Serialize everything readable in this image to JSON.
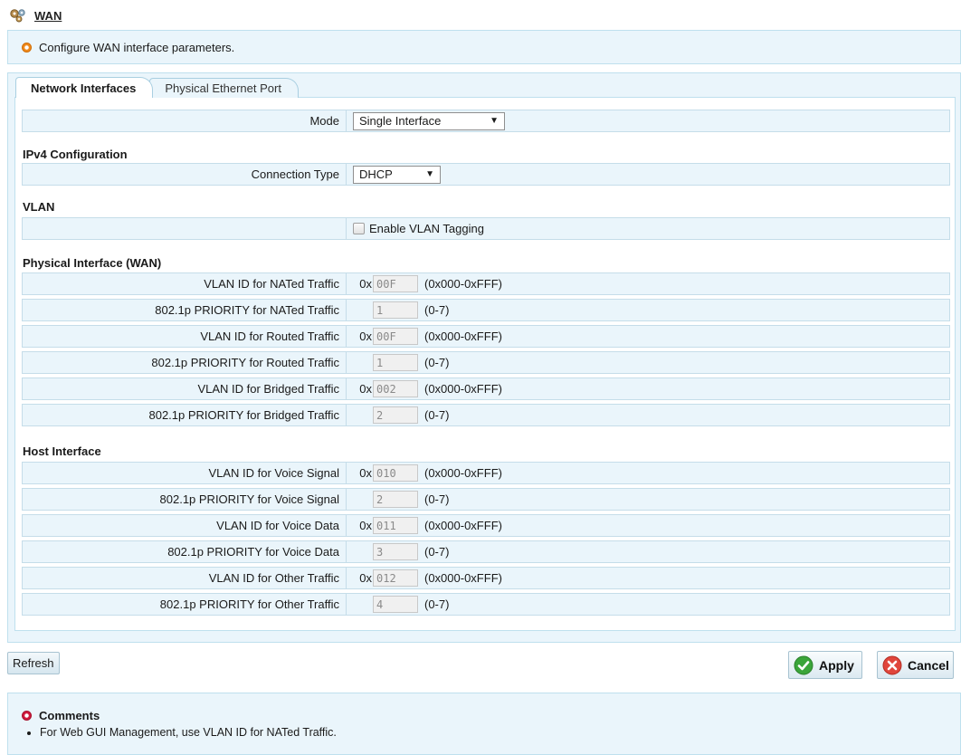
{
  "header": {
    "title": "WAN",
    "icon": "gears-icon"
  },
  "info": {
    "text": "Configure WAN interface parameters."
  },
  "tabs": [
    {
      "label": "Network Interfaces",
      "active": true
    },
    {
      "label": "Physical Ethernet Port",
      "active": false
    }
  ],
  "mode": {
    "label": "Mode",
    "value": "Single Interface"
  },
  "ipv4": {
    "title": "IPv4 Configuration",
    "connection_type_label": "Connection Type",
    "connection_type_value": "DHCP"
  },
  "vlan": {
    "title": "VLAN",
    "enable_tagging_label": "Enable VLAN Tagging",
    "enable_tagging_checked": false
  },
  "physical": {
    "title": "Physical Interface (WAN)",
    "rows": [
      {
        "label": "VLAN ID for NATed Traffic",
        "prefix": "0x",
        "value": "00F",
        "range": "(0x000-0xFFF)"
      },
      {
        "label": "802.1p PRIORITY for NATed Traffic",
        "prefix": "",
        "value": "1",
        "range": "(0-7)"
      },
      {
        "label": "VLAN ID for Routed Traffic",
        "prefix": "0x",
        "value": "00F",
        "range": "(0x000-0xFFF)"
      },
      {
        "label": "802.1p PRIORITY for Routed Traffic",
        "prefix": "",
        "value": "1",
        "range": "(0-7)"
      },
      {
        "label": "VLAN ID for Bridged Traffic",
        "prefix": "0x",
        "value": "002",
        "range": "(0x000-0xFFF)"
      },
      {
        "label": "802.1p PRIORITY for Bridged Traffic",
        "prefix": "",
        "value": "2",
        "range": "(0-7)"
      }
    ]
  },
  "host": {
    "title": "Host Interface",
    "rows": [
      {
        "label": "VLAN ID for Voice Signal",
        "prefix": "0x",
        "value": "010",
        "range": "(0x000-0xFFF)"
      },
      {
        "label": "802.1p PRIORITY for Voice Signal",
        "prefix": "",
        "value": "2",
        "range": "(0-7)"
      },
      {
        "label": "VLAN ID for Voice Data",
        "prefix": "0x",
        "value": "011",
        "range": "(0x000-0xFFF)"
      },
      {
        "label": "802.1p PRIORITY for Voice Data",
        "prefix": "",
        "value": "3",
        "range": "(0-7)"
      },
      {
        "label": "VLAN ID for Other Traffic",
        "prefix": "0x",
        "value": "012",
        "range": "(0x000-0xFFF)"
      },
      {
        "label": "802.1p PRIORITY for Other Traffic",
        "prefix": "",
        "value": "4",
        "range": "(0-7)"
      }
    ]
  },
  "buttons": {
    "refresh": "Refresh",
    "apply": "Apply",
    "cancel": "Cancel"
  },
  "comments": {
    "title": "Comments",
    "items": [
      "For Web GUI Management, use VLAN ID for NATed Traffic."
    ]
  },
  "colors": {
    "panel_bg": "#eaf5fb",
    "border": "#bfe0ee",
    "info_dot": "#ef8a1c",
    "comment_dot": "#d01b3f",
    "apply_green": "#3aa53a",
    "cancel_red": "#e0463c"
  }
}
